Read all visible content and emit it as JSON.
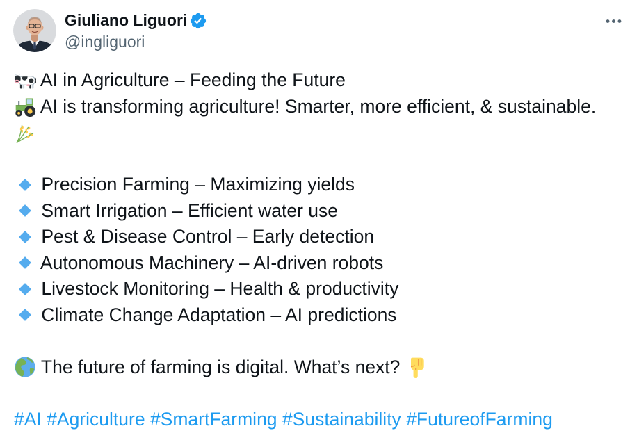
{
  "post": {
    "author": {
      "name": "Giuliano Liguori",
      "handle": "@ingliguori",
      "verified": true,
      "verified_icon": "verified-badge-icon"
    },
    "more_icon": "more-options-icon",
    "text": {
      "intro": [
        {
          "icon": "cow-icon",
          "text": "AI in Agriculture – Feeding the Future"
        },
        {
          "icon": "tractor-icon",
          "text": "AI is transforming agriculture! Smarter, more efficient, & sustainable.",
          "trailing_icon": "sheaf-of-rice-icon"
        }
      ],
      "bullets": [
        {
          "icon": "small-blue-diamond-icon",
          "text": "Precision Farming – Maximizing yields"
        },
        {
          "icon": "small-blue-diamond-icon",
          "text": "Smart Irrigation – Efficient water use"
        },
        {
          "icon": "small-blue-diamond-icon",
          "text": "Pest & Disease Control – Early detection"
        },
        {
          "icon": "small-blue-diamond-icon",
          "text": "Autonomous Machinery – AI-driven robots"
        },
        {
          "icon": "small-blue-diamond-icon",
          "text": "Livestock Monitoring – Health & productivity"
        },
        {
          "icon": "small-blue-diamond-icon",
          "text": "Climate Change Adaptation – AI predictions"
        }
      ],
      "closing": {
        "icon": "globe-europe-africa-icon",
        "text": "The future of farming is digital. What’s next?",
        "trailing_icon": "backhand-index-pointing-down-icon"
      },
      "hashtags": [
        "#AI",
        "#Agriculture",
        "#SmartFarming",
        "#Sustainability",
        "#FutureofFarming"
      ]
    }
  },
  "colors": {
    "background": "#ffffff",
    "text": "#0f1419",
    "secondary_text": "#536471",
    "link": "#1d9bf0",
    "verified": "#1d9bf0",
    "bullet_diamond": "#55acee"
  }
}
